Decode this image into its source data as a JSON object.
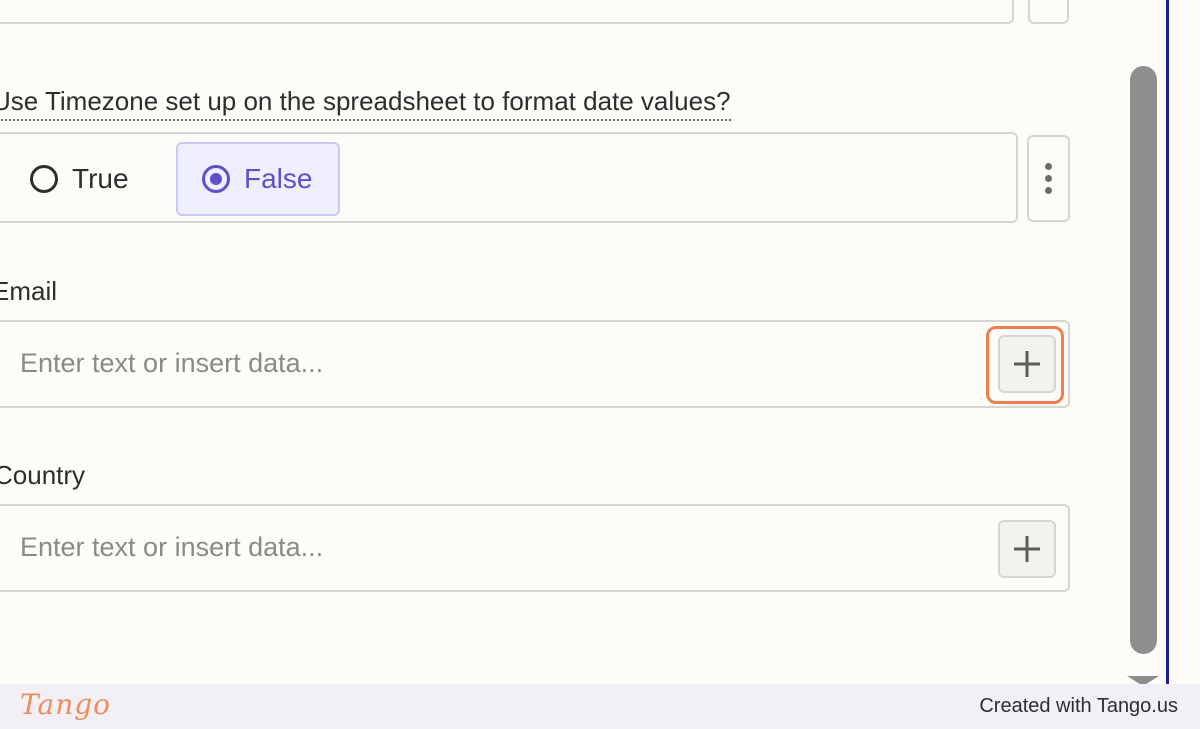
{
  "form": {
    "timezone_question": "Use Timezone set up on the spreadsheet to format date values?",
    "timezone_options": [
      {
        "label": "True",
        "selected": false
      },
      {
        "label": "False",
        "selected": true
      }
    ],
    "email": {
      "label": "Email",
      "placeholder": "Enter text or insert data..."
    },
    "country": {
      "label": "Country",
      "placeholder": "Enter text or insert data..."
    }
  },
  "footer": {
    "logo": "Tango",
    "credit": "Created with Tango.us"
  },
  "colors": {
    "accent": "#5b52c7",
    "highlight": "#ee7f4b",
    "background": "#fdfcf8",
    "scrollbar_border": "#1c1c9e"
  },
  "icons": [
    "radio-unchecked-icon",
    "radio-checked-icon",
    "kebab-menu-icon",
    "plus-icon",
    "scroll-down-arrow-icon"
  ]
}
